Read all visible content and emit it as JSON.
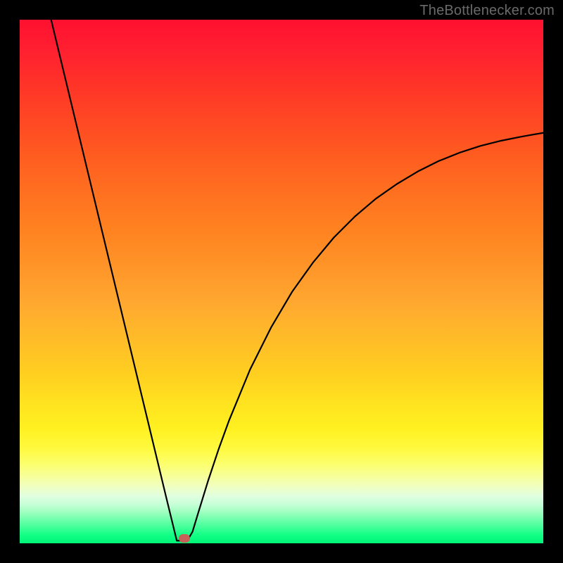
{
  "attribution": "TheBottlenecker.com",
  "colors": {
    "frame": "#000000",
    "curve": "#000000",
    "marker": "#c66058",
    "gradient_top": "#ff1030",
    "gradient_bottom": "#00f578"
  },
  "chart_data": {
    "type": "line",
    "title": "",
    "xlabel": "",
    "ylabel": "",
    "xlim": [
      0,
      100
    ],
    "ylim": [
      0,
      100
    ],
    "series": [
      {
        "name": "bottleneck-curve",
        "x": [
          6,
          8,
          10,
          12,
          14,
          16,
          18,
          20,
          22,
          24,
          26,
          28,
          29,
          30,
          31,
          32,
          33,
          34,
          36,
          38,
          40,
          44,
          48,
          52,
          56,
          60,
          64,
          68,
          72,
          76,
          80,
          84,
          88,
          92,
          96,
          100
        ],
        "y": [
          100,
          91.7,
          83.4,
          75.1,
          66.8,
          58.5,
          50.2,
          41.9,
          33.6,
          25.3,
          17.0,
          8.7,
          4.6,
          0.5,
          0.5,
          0.5,
          2.2,
          5.5,
          12.0,
          18.0,
          23.5,
          33.2,
          41.2,
          48.0,
          53.6,
          58.4,
          62.4,
          65.8,
          68.6,
          71.0,
          73.0,
          74.6,
          75.9,
          76.9,
          77.7,
          78.4
        ]
      }
    ],
    "marker": {
      "x": 31.5,
      "y": 0.9
    },
    "grid": false,
    "legend_position": "none"
  }
}
